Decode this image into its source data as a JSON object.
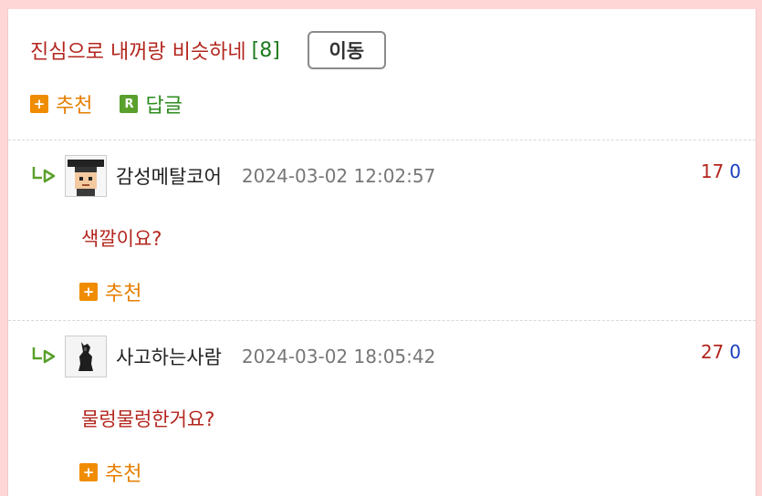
{
  "post": {
    "title": "진심으로 내꺼랑 비슷하네",
    "comment_count": "[8]",
    "move_button": "이동",
    "recommend_label": "추천",
    "reply_label": "답글",
    "recommend_icon_glyph": "+",
    "reply_icon_glyph": "R"
  },
  "comments": [
    {
      "author": "감성메탈코어",
      "date": "2024-03-02 12:02:57",
      "upvotes": "17",
      "downvotes": "0",
      "text": "색깔이요?",
      "recommend_label": "추천",
      "avatar_icon": "pixel-character-avatar"
    },
    {
      "author": "사고하는사람",
      "date": "2024-03-02 18:05:42",
      "upvotes": "27",
      "downvotes": "0",
      "text": "물렁물렁한거요?",
      "recommend_label": "추천",
      "avatar_icon": "dark-figure-avatar"
    }
  ],
  "colors": {
    "title": "#b3261e",
    "count": "#1f7a1f",
    "recommend": "#e67e00",
    "reply": "#2e8b20",
    "upvote": "#b3261e",
    "downvote": "#1a3fbf",
    "background": "#ffd6d6"
  }
}
